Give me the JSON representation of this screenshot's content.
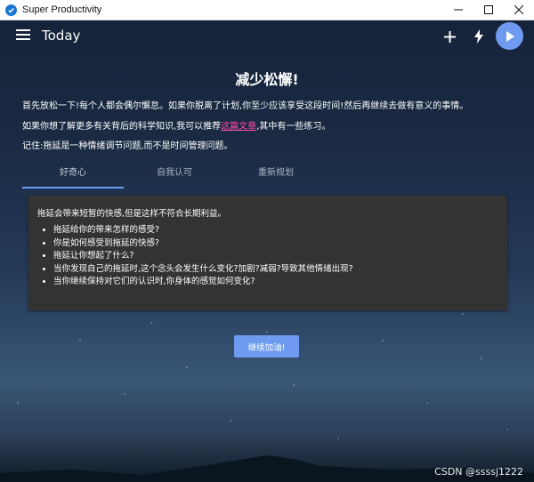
{
  "window": {
    "title": "Super Productivity",
    "icon": "app-check-icon",
    "controls": [
      "minimize-icon",
      "maximize-icon",
      "close-icon"
    ]
  },
  "toolbar": {
    "title": "Today",
    "icons": [
      "menu-icon",
      "add-icon",
      "flash-icon",
      "play-icon"
    ],
    "accent": "#6e9bf0"
  },
  "content": {
    "heading": "减少松懈!",
    "para1": "首先放松一下!每个人都会偶尔懈怠。如果你脱离了计划,你至少应该享受这段时间!然后再继续去做有意义的事情。",
    "para2_before": "如果你想了解更多有关背后的科学知识,我可以推荐",
    "para2_link": "这篇文章",
    "para2_after": ",其中有一些练习。",
    "para3": "记住:拖延是一种情绪调节问题,而不是时间管理问题。",
    "link_color": "#ff4aa5"
  },
  "tabs": [
    {
      "label": "好奇心",
      "active": true
    },
    {
      "label": "自我认可",
      "active": false
    },
    {
      "label": "重新规划",
      "active": false
    }
  ],
  "card": {
    "intro": "拖延会带来短暂的快感,但是这样不符合长期利益。",
    "items": [
      "拖延给你的带来怎样的感受?",
      "你是如何感受到拖延的快感?",
      "拖延让你想起了什么?",
      "当你发现自己的拖延时,这个念头会发生什么变化?加剧?减弱?导致其他情绪出现?",
      "当你继续保持对它们的认识时,你身体的感觉如何变化?"
    ]
  },
  "button": {
    "continue_label": "继续加油!"
  },
  "watermark": "CSDN @ssssj1222"
}
